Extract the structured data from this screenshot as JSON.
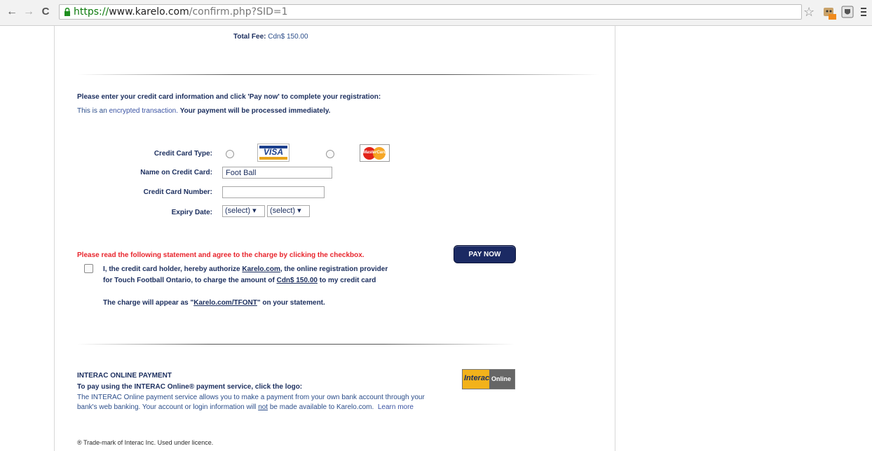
{
  "browser": {
    "url_scheme": "https://",
    "url_host": "www.karelo.com",
    "url_path": "/confirm.php?SID=1"
  },
  "fee": {
    "label": "Total Fee:",
    "value": "Cdn$ 150.00"
  },
  "instructions": {
    "main": "Please enter your credit card information and click 'Pay now' to complete your registration:",
    "encrypted_prefix": "This is an",
    "encrypted_link": "encrypted transaction.",
    "encrypted_suffix": "Your payment will be processed immediately."
  },
  "form": {
    "card_type_label": "Credit Card Type:",
    "visa_text": "VISA",
    "mastercard_text": "MasterCard",
    "name_label": "Name on Credit Card:",
    "name_value": "Foot Ball",
    "number_label": "Credit Card Number:",
    "number_value": "",
    "expiry_label": "Expiry Date:",
    "month_select": "(select)",
    "year_select": "(select)"
  },
  "agreement": {
    "warning": "Please read the following statement and agree to the charge by clicking the checkbox.",
    "line1_prefix": "I, the credit card holder, hereby authorize",
    "line1_link": "Karelo.com",
    "line1_suffix": ", the online registration provider",
    "line2_prefix": "for Touch Football Ontario, to charge the amount of",
    "line2_link": "Cdn$ 150.00",
    "line2_suffix": "to my credit card",
    "line3_prefix": "The charge will appear as \"",
    "line3_link": "Karelo.com/TFONT",
    "line3_suffix": "\" on your statement.",
    "pay_button": "PAY NOW"
  },
  "interac": {
    "heading": "INTERAC ONLINE PAYMENT",
    "subheading": "To pay using the INTERAC Online® payment service, click the logo:",
    "body_1": "The INTERAC Online payment service allows you to make a payment from your own bank account through your bank's web banking. Your account or login information will",
    "body_not": "not",
    "body_2": "be made available to Karelo.com.",
    "learn_more": "Learn more",
    "trademark": "® Trade-mark of Interac Inc. Used under licence.",
    "logo_left": "Interac",
    "logo_right": "Online"
  }
}
